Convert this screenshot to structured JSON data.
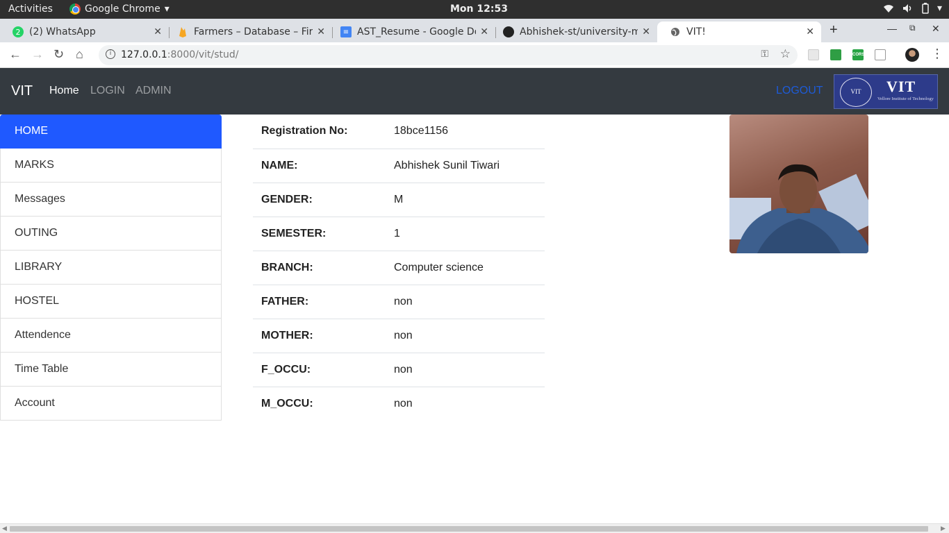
{
  "topbar": {
    "activities": "Activities",
    "app_name": "Google Chrome",
    "clock": "Mon 12:53"
  },
  "tabs": [
    {
      "title": "(2) WhatsApp",
      "badge": "2",
      "active": false
    },
    {
      "title": "Farmers – Database – Fire",
      "active": false
    },
    {
      "title": "AST_Resume - Google Do",
      "active": false
    },
    {
      "title": "Abhishek-st/university-m",
      "active": false
    },
    {
      "title": "VIT!",
      "active": true
    }
  ],
  "omnibox": {
    "host": "127.0.0.1",
    "path": ":8000/vit/stud/"
  },
  "extensions": {
    "cors_label": "CORS"
  },
  "site": {
    "brand": "VIT",
    "nav": [
      {
        "label": "Home",
        "active": true
      },
      {
        "label": "LOGIN",
        "active": false
      },
      {
        "label": "ADMIN",
        "active": false
      }
    ],
    "logout": "LOGOUT",
    "logo": {
      "seal_text": "VIT",
      "word": "VIT",
      "subtitle": "Vellore Institute of Technology"
    }
  },
  "sidebar": {
    "items": [
      {
        "label": "HOME",
        "active": true
      },
      {
        "label": "MARKS",
        "active": false
      },
      {
        "label": "Messages",
        "active": false
      },
      {
        "label": "OUTING",
        "active": false
      },
      {
        "label": "LIBRARY",
        "active": false
      },
      {
        "label": "HOSTEL",
        "active": false
      },
      {
        "label": "Attendence",
        "active": false
      },
      {
        "label": "Time Table",
        "active": false
      },
      {
        "label": "Account",
        "active": false
      }
    ]
  },
  "student": {
    "rows": [
      {
        "label": "Registration No:",
        "value": "18bce1156"
      },
      {
        "label": "NAME:",
        "value": "Abhishek Sunil Tiwari"
      },
      {
        "label": "GENDER:",
        "value": "M"
      },
      {
        "label": "SEMESTER:",
        "value": "1"
      },
      {
        "label": "BRANCH:",
        "value": "Computer science"
      },
      {
        "label": "FATHER:",
        "value": "non"
      },
      {
        "label": "MOTHER:",
        "value": "non"
      },
      {
        "label": "F_OCCU:",
        "value": "non"
      },
      {
        "label": "M_OCCU:",
        "value": "non"
      }
    ]
  },
  "colors": {
    "navbar_bg": "#343a40",
    "sidebar_active": "#1f59ff",
    "logout_link": "#1d5bd8"
  }
}
